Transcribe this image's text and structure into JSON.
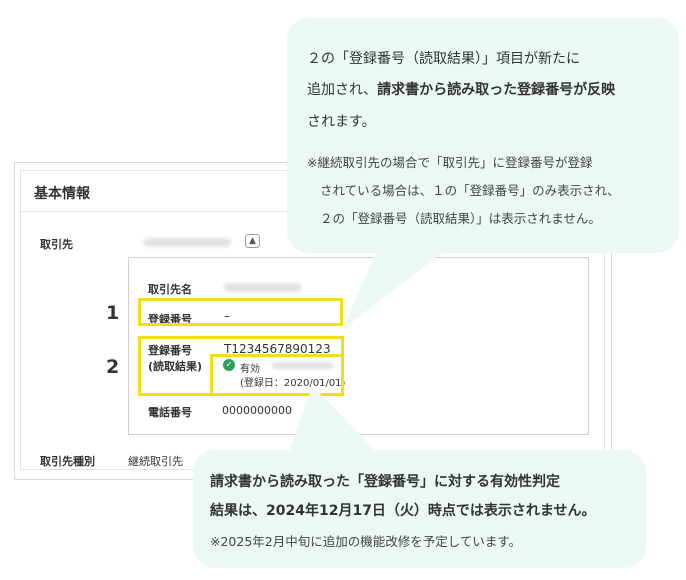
{
  "panel": {
    "title": "基本情報",
    "fields": {
      "torihikisaki": "取引先",
      "torihikisaki_shubetsu": "取引先種別",
      "torihikisaki_shubetsu_value": "継続取引先"
    },
    "expand_icon": "chevron-up-icon"
  },
  "detail": {
    "name_label": "取引先名",
    "reg_label": "登録番号",
    "reg_value": "–",
    "reg_read_label_1": "登録番号",
    "reg_read_label_2": "(読取結果)",
    "reg_read_value": "T1234567890123",
    "validity_label": "有効",
    "reg_date": "(登録日：2020/01/01)",
    "phone_label": "電話番号",
    "phone_value": "0000000000"
  },
  "markers": {
    "one": "1",
    "two": "2"
  },
  "callout_top": {
    "line1": "２の「登録番号（読取結果）」項目が新たに",
    "line2_pre": "追加され、",
    "line2_bold": "請求書から読み取った登録番号が反映",
    "line3": "されます。",
    "note1": "※継続取引先の場合で「取引先」に登録番号が登録",
    "note2": "されている場合は、１の「登録番号」のみ表示され、",
    "note3": "２の「登録番号（読取結果）」は表示されません。"
  },
  "callout_bottom": {
    "line1": "請求書から読み取った「登録番号」に対する有効性判定",
    "line2": "結果は、2024年12月17日（火）時点では表示されません。",
    "note": "※2025年2月中旬に追加の機能改修を予定しています。"
  },
  "colors": {
    "highlight": "#f2de1b",
    "callout_bg": "#ebf8f3",
    "valid_green": "#2aa05a"
  }
}
